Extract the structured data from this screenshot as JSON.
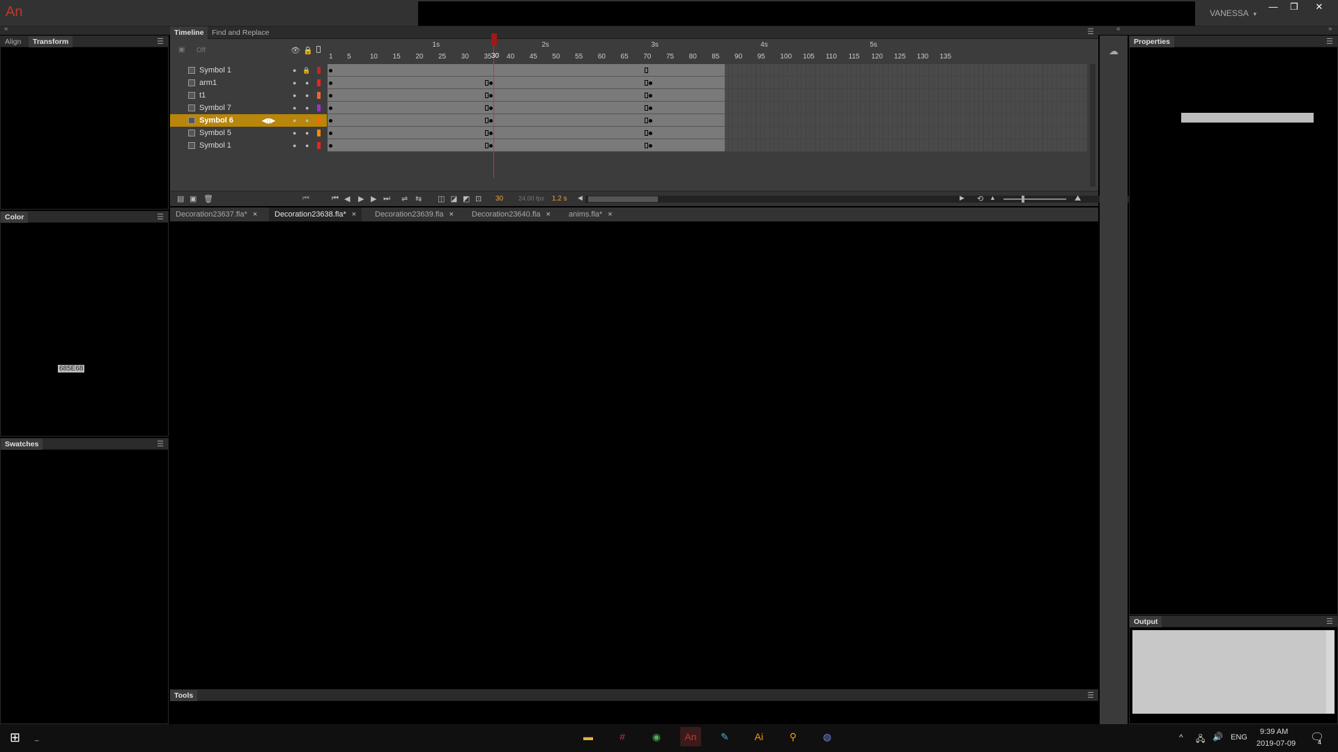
{
  "app": {
    "logo": "An",
    "user": "VANESSA",
    "user_menu": "▾"
  },
  "window_controls": {
    "minimize": "—",
    "restore": "❐",
    "close": "✕"
  },
  "left_panels": {
    "top": {
      "tabs": [
        "Align",
        "Transform"
      ],
      "active": "Transform"
    },
    "color": {
      "tab": "Color",
      "hex_value": "685E68"
    },
    "swatches": {
      "tab": "Swatches"
    }
  },
  "timeline": {
    "tabs": [
      "Timeline",
      "Find and Replace"
    ],
    "onion_label": "Off",
    "seconds": [
      "1s",
      "2s",
      "3s",
      "4s",
      "5s"
    ],
    "frame_numbers": [
      "1",
      "5",
      "10",
      "15",
      "20",
      "25",
      "30",
      "35",
      "40",
      "45",
      "50",
      "55",
      "60",
      "65",
      "70",
      "75",
      "80",
      "85",
      "90",
      "95",
      "100",
      "105",
      "110",
      "115",
      "120",
      "125",
      "130",
      "135"
    ],
    "current_frame": "30",
    "fps": "24.00 fps",
    "time": "1.2 s",
    "layers": [
      {
        "name": "Symbol 1",
        "color": "#cc2222",
        "locked": true,
        "selected": false
      },
      {
        "name": "arm1",
        "color": "#ee2222",
        "locked": false,
        "selected": false
      },
      {
        "name": "t1",
        "color": "#ee6633",
        "locked": false,
        "selected": false
      },
      {
        "name": "Symbol 7",
        "color": "#9933cc",
        "locked": false,
        "selected": false
      },
      {
        "name": "Symbol 6",
        "color": "#ff6600",
        "locked": false,
        "selected": true
      },
      {
        "name": "Symbol 5",
        "color": "#ff8800",
        "locked": false,
        "selected": false
      },
      {
        "name": "Symbol 1",
        "color": "#ee2222",
        "locked": false,
        "selected": false
      }
    ]
  },
  "documents": [
    {
      "name": "Decoration23637.fla*",
      "active": false
    },
    {
      "name": "Decoration23638.fla*",
      "active": true
    },
    {
      "name": "Decoration23639.fla",
      "active": false
    },
    {
      "name": "Decoration23640.fla",
      "active": false
    },
    {
      "name": "anims.fla*",
      "active": false
    }
  ],
  "doc_close": "×",
  "tools_panel": {
    "tab": "Tools"
  },
  "properties_panel": {
    "tab": "Properties"
  },
  "output_panel": {
    "tab": "Output"
  },
  "taskbar": {
    "time": "9:39 AM",
    "date": "2019-07-09",
    "lang": "ENG",
    "notification_count": "4",
    "apps": [
      "file-explorer",
      "slack",
      "chrome",
      "animate",
      "paint",
      "illustrator",
      "search-app",
      "discord"
    ]
  }
}
